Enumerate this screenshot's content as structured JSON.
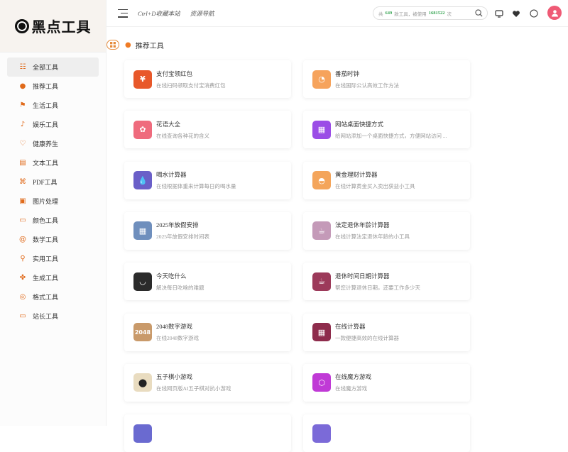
{
  "logo": {
    "text": "黑点工具"
  },
  "sidebar": {
    "items": [
      {
        "label": "全部工具",
        "icon": "list-icon",
        "glyph": "☷",
        "active": true
      },
      {
        "label": "推荐工具",
        "icon": "fire-icon",
        "glyph": "●"
      },
      {
        "label": "生活工具",
        "icon": "flag-icon",
        "glyph": "⚑"
      },
      {
        "label": "娱乐工具",
        "icon": "music-icon",
        "glyph": "♪"
      },
      {
        "label": "健康养生",
        "icon": "heart-icon",
        "glyph": "♡"
      },
      {
        "label": "文本工具",
        "icon": "document-icon",
        "glyph": "▤"
      },
      {
        "label": "PDF工具",
        "icon": "pdf-icon",
        "glyph": "⌘"
      },
      {
        "label": "图片处理",
        "icon": "image-icon",
        "glyph": "▣"
      },
      {
        "label": "颜色工具",
        "icon": "monitor-icon",
        "glyph": "▭"
      },
      {
        "label": "数学工具",
        "icon": "at-icon",
        "glyph": "@"
      },
      {
        "label": "实用工具",
        "icon": "search-icon",
        "glyph": "⚲"
      },
      {
        "label": "生成工具",
        "icon": "puzzle-icon",
        "glyph": "✤"
      },
      {
        "label": "格式工具",
        "icon": "format-icon",
        "glyph": "◎"
      },
      {
        "label": "站长工具",
        "icon": "desktop-icon",
        "glyph": "▭"
      }
    ]
  },
  "header": {
    "bookmark_hint": "Ctrl+D收藏本站",
    "nav_link": "资源导航",
    "stats": {
      "prefix": "共",
      "tool_count": "649",
      "mid": "款工具，被使用",
      "use_count": "1681522",
      "suffix": "次"
    }
  },
  "section": {
    "title": "推荐工具"
  },
  "cards": [
    {
      "title": "支付宝领红包",
      "desc": "在线扫码领取支付宝消费红包",
      "icon": "alipay-icon",
      "glyph": "¥",
      "bg": "#e8582a"
    },
    {
      "title": "番茄时钟",
      "desc": "在线国际公认高效工作方法",
      "icon": "tomato-icon",
      "glyph": "◔",
      "bg": "#f6a35c"
    },
    {
      "title": "花语大全",
      "desc": "在线查询各种花的含义",
      "icon": "flower-icon",
      "glyph": "✿",
      "bg": "#ef6b7d"
    },
    {
      "title": "网站桌面快捷方式",
      "desc": "给网站添加一个桌面快捷方式，方便网站访问 ...",
      "icon": "grid-icon",
      "glyph": "▦",
      "bg": "#9b4de6"
    },
    {
      "title": "喝水计算器",
      "desc": "在线根据体重来计算每日的喝水量",
      "icon": "water-drop-icon",
      "glyph": "💧",
      "bg": "#6a5fc8"
    },
    {
      "title": "黄金理财计算器",
      "desc": "在线计算黄金买入卖出获益小工具",
      "icon": "gold-icon",
      "glyph": "◓",
      "bg": "#f4a55b"
    },
    {
      "title": "2025年放假安排",
      "desc": "2025年放假安排时间表",
      "icon": "calendar-icon",
      "glyph": "▦",
      "bg": "#6f8fbd"
    },
    {
      "title": "法定退休年龄计算器",
      "desc": "在线计算法定退休年龄的小工具",
      "icon": "coffee-icon",
      "glyph": "☕",
      "bg": "#c49ab8"
    },
    {
      "title": "今天吃什么",
      "desc": "解决每日吃啥的难题",
      "icon": "bowl-icon",
      "glyph": "◡",
      "bg": "#2b2b2b"
    },
    {
      "title": "退休时间日期计算器",
      "desc": "帮您计算退休日期，还要工作多少天",
      "icon": "cup-icon",
      "glyph": "☕",
      "bg": "#9c3a5a"
    },
    {
      "title": "2048数字游戏",
      "desc": "在线2048数字游戏",
      "icon": "game-2048-icon",
      "glyph": "2048",
      "bg": "#c99a6a"
    },
    {
      "title": "在线计算器",
      "desc": "一款便捷高效的在线计算器",
      "icon": "calculator-icon",
      "glyph": "▦",
      "bg": "#8e2c4c"
    },
    {
      "title": "五子棋小游戏",
      "desc": "在线网页版AI五子棋对抗小游戏",
      "icon": "gomoku-icon",
      "glyph": "⬤",
      "bg": "#e9dcc0"
    },
    {
      "title": "在线魔方游戏",
      "desc": "在线魔方游戏",
      "icon": "cube-icon",
      "glyph": "⬡",
      "bg": "#c03ad6"
    },
    {
      "title": "",
      "desc": "",
      "icon": "tool-icon",
      "glyph": "",
      "bg": "#6a6ad0"
    },
    {
      "title": "",
      "desc": "",
      "icon": "tool-icon",
      "glyph": "",
      "bg": "#7b6ad8"
    }
  ]
}
